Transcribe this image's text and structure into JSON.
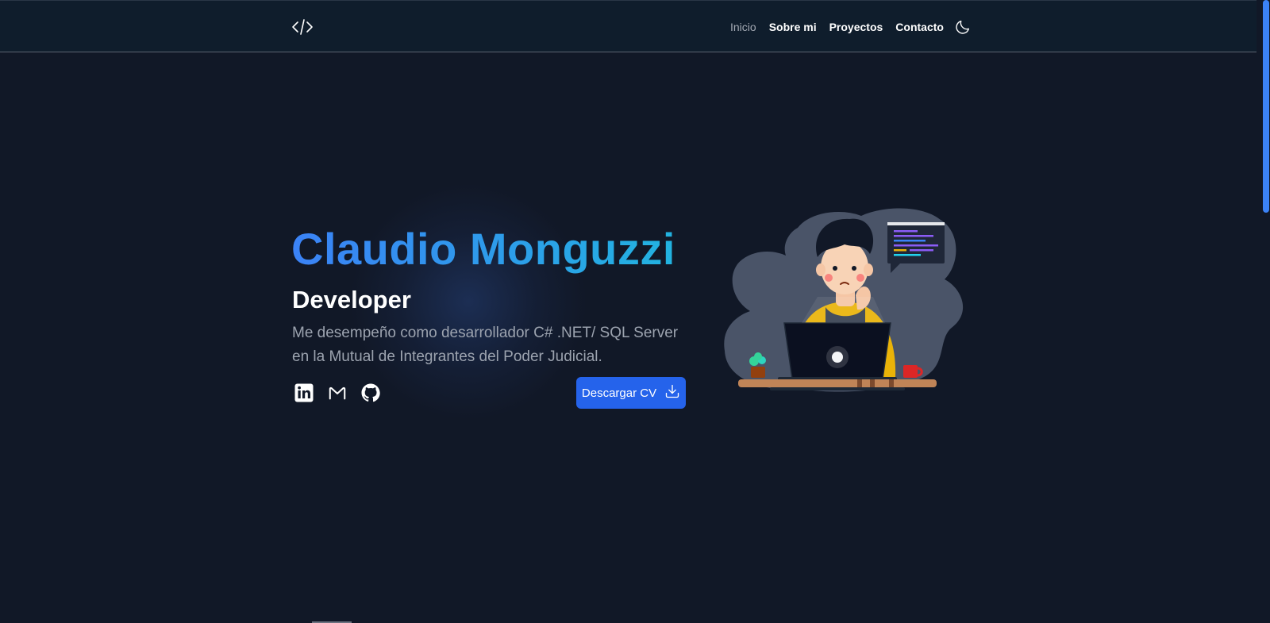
{
  "nav": {
    "logo_icon": "code-brackets-icon",
    "links": [
      {
        "label": "Inicio",
        "active": true
      },
      {
        "label": "Sobre mi",
        "active": false
      },
      {
        "label": "Proyectos",
        "active": false
      },
      {
        "label": "Contacto",
        "active": false
      }
    ],
    "theme_icon": "moon-icon"
  },
  "hero": {
    "name": "Claudio Monguzzi",
    "role": "Developer",
    "description": "Me desempeño como desarrollador C# .NET/ SQL Server en la Mutual de Integrantes del Poder Judicial.",
    "socials": [
      {
        "icon": "linkedin-icon"
      },
      {
        "icon": "gmail-icon"
      },
      {
        "icon": "github-icon"
      }
    ],
    "cv_button": {
      "label": "Descargar CV",
      "icon": "download-icon"
    },
    "illustration": "developer-at-laptop-illustration"
  },
  "colors": {
    "background": "#111827",
    "navbar": "#0f1d2c",
    "accent": "#2563eb",
    "name_gradient_start": "#3b82f6",
    "name_gradient_end": "#22b3e0",
    "muted_text": "#9ca3af"
  }
}
